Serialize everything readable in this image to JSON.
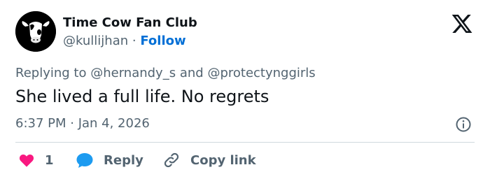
{
  "author": {
    "display_name": "Time Cow Fan Club",
    "handle": "@kullijhan",
    "separator": "·",
    "follow_label": "Follow",
    "avatar_icon": "cow-avatar-icon"
  },
  "platform": {
    "logo_icon": "x-logo-icon"
  },
  "reply_context": {
    "prefix": "Replying to",
    "mention_1": "@hernandy_s",
    "joiner": "and",
    "mention_2": "@protectynggirls"
  },
  "tweet": {
    "text": "She lived a full life. No regrets",
    "timestamp": "6:37 PM · Jan 4, 2026"
  },
  "actions": {
    "like_count": "1",
    "reply_label": "Reply",
    "copy_link_label": "Copy link"
  },
  "colors": {
    "link_blue": "#006fd6",
    "like_pink": "#f91880",
    "reply_blue": "#1d9bf0",
    "muted_gray": "#536471",
    "divider": "#cfd9de"
  }
}
